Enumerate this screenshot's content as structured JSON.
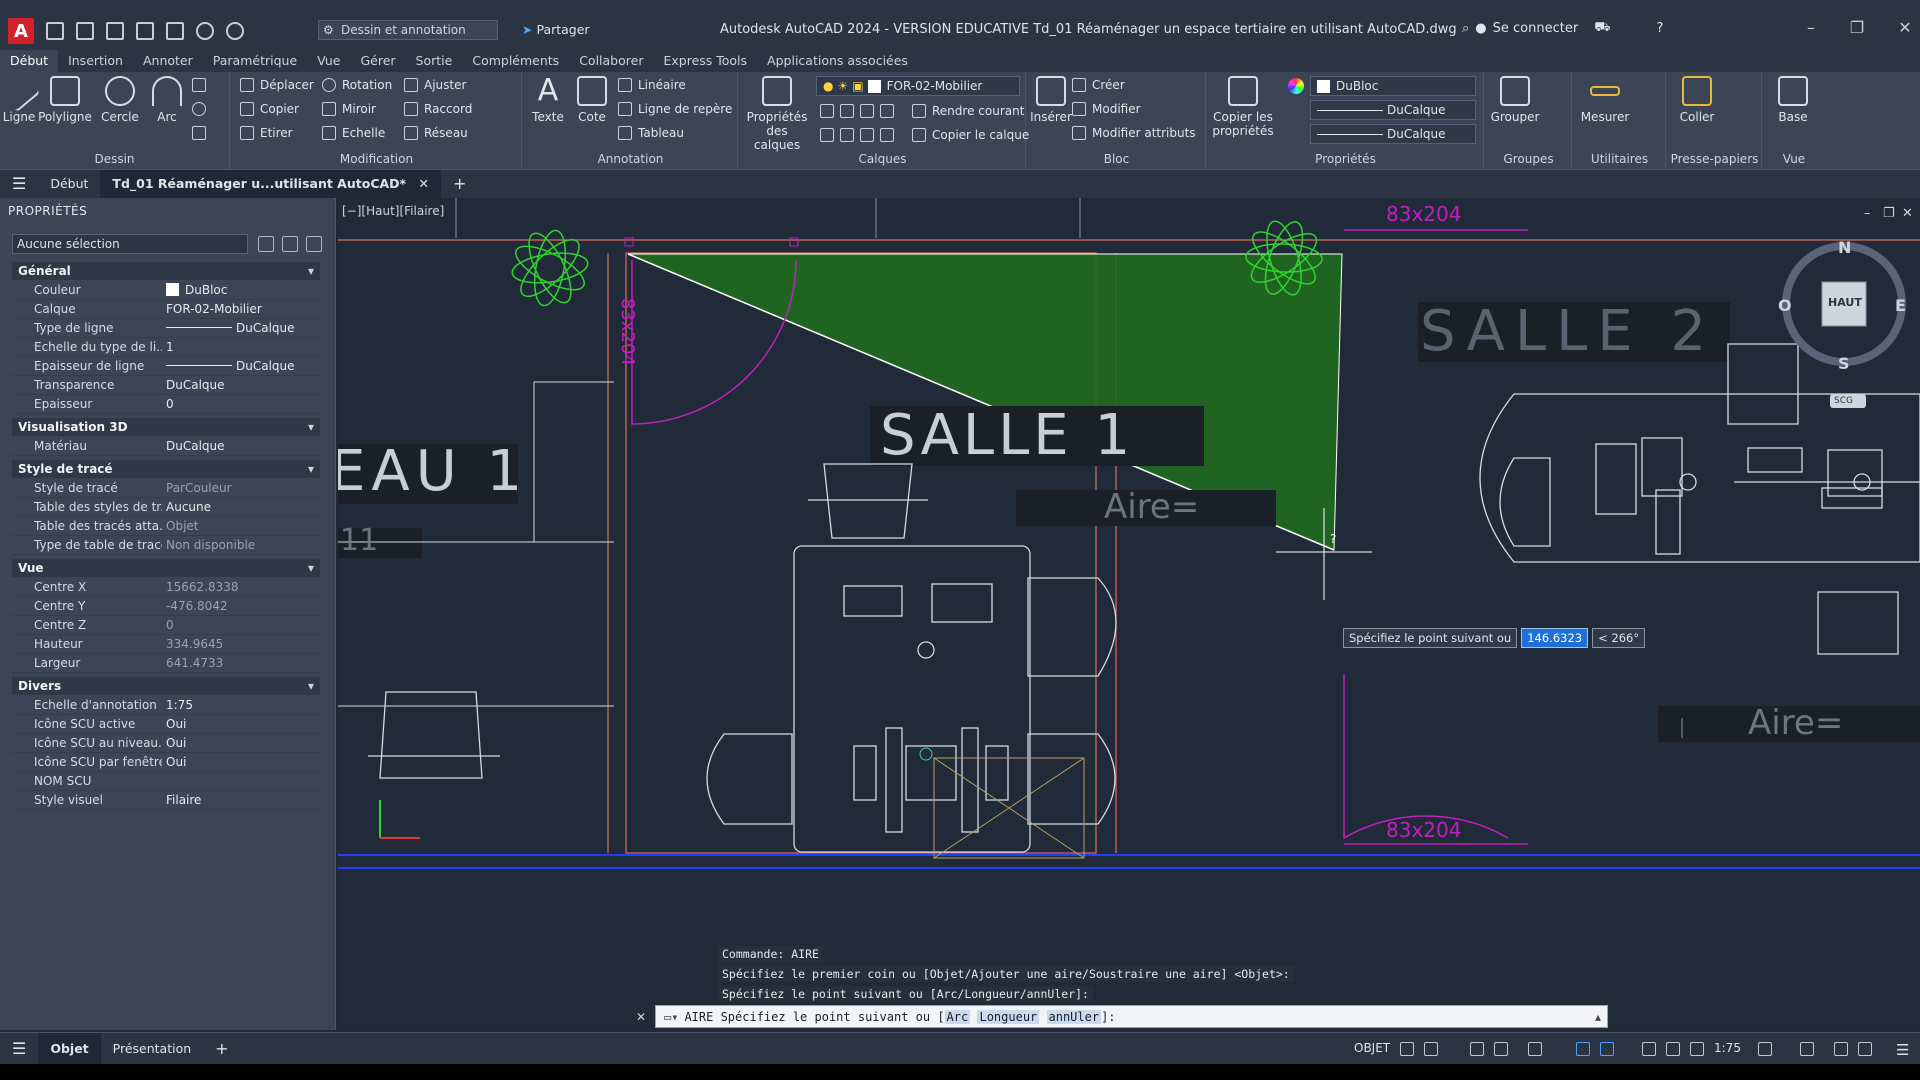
{
  "titlebar": {
    "workspace": "Dessin et annotation",
    "share": "Partager",
    "title": "Autodesk AutoCAD 2024 - VERSION EDUCATIVE    Td_01 Réaménager un espace tertiaire en utilisant AutoCAD.dwg",
    "signin": "Se connecter"
  },
  "menu": [
    "Début",
    "Insertion",
    "Annoter",
    "Paramétrique",
    "Vue",
    "Gérer",
    "Sortie",
    "Compléments",
    "Collaborer",
    "Express Tools",
    "Applications associées"
  ],
  "ribbon": {
    "dessin": {
      "label": "Dessin",
      "ligne": "Ligne",
      "polyligne": "Polyligne",
      "cercle": "Cercle",
      "arc": "Arc"
    },
    "modification": {
      "label": "Modification",
      "deplacer": "Déplacer",
      "rotation": "Rotation",
      "ajuster": "Ajuster",
      "copier": "Copier",
      "miroir": "Miroir",
      "raccord": "Raccord",
      "etirer": "Etirer",
      "echelle": "Echelle",
      "reseau": "Réseau"
    },
    "annotation": {
      "label": "Annotation",
      "texte": "Texte",
      "cote": "Cote",
      "lineaire": "Linéaire",
      "ligne_repere": "Ligne de repère",
      "tableau": "Tableau"
    },
    "calques": {
      "label": "Calques",
      "proprietes": "Propriétés des calques",
      "layer": "FOR-02-Mobilier",
      "rendre_courant": "Rendre courant",
      "copier_calque": "Copier le calque"
    },
    "bloc": {
      "label": "Bloc",
      "inserer": "Insérer",
      "creer": "Créer",
      "modifier": "Modifier",
      "modifier_attributs": "Modifier attributs"
    },
    "proprietes": {
      "label": "Propriétés",
      "copier": "Copier les propriétés",
      "color": "DuBloc",
      "linetype": "DuCalque",
      "lineweight": "DuCalque"
    },
    "groupes": {
      "label": "Groupes",
      "grouper": "Grouper"
    },
    "utilitaires": {
      "label": "Utilitaires",
      "mesurer": "Mesurer"
    },
    "presse": {
      "label": "Presse-papiers",
      "coller": "Coller"
    },
    "vue": {
      "label": "Vue",
      "base": "Base"
    }
  },
  "doctabs": {
    "start": "Début",
    "current": "Td_01 Réaménager u...utilisant AutoCAD*"
  },
  "properties": {
    "title": "PROPRIÉTÉS",
    "selection": "Aucune sélection",
    "sections": {
      "general": "Général",
      "vis3d": "Visualisation 3D",
      "trace": "Style de tracé",
      "vue": "Vue",
      "divers": "Divers"
    },
    "general": [
      {
        "k": "Couleur",
        "v": "DuBloc"
      },
      {
        "k": "Calque",
        "v": "FOR-02-Mobilier"
      },
      {
        "k": "Type de ligne",
        "v": "DuCalque"
      },
      {
        "k": "Echelle du type de li...",
        "v": "1"
      },
      {
        "k": "Epaisseur de ligne",
        "v": "DuCalque"
      },
      {
        "k": "Transparence",
        "v": "DuCalque"
      },
      {
        "k": "Epaisseur",
        "v": "0"
      }
    ],
    "vis3d": [
      {
        "k": "Matériau",
        "v": "DuCalque"
      }
    ],
    "trace": [
      {
        "k": "Style de tracé",
        "v": "ParCouleur"
      },
      {
        "k": "Table des styles de tr...",
        "v": "Aucune"
      },
      {
        "k": "Table des tracés atta...",
        "v": "Objet"
      },
      {
        "k": "Type de table de tracé",
        "v": "Non disponible"
      }
    ],
    "vue": [
      {
        "k": "Centre X",
        "v": "15662.8338"
      },
      {
        "k": "Centre Y",
        "v": "-476.8042"
      },
      {
        "k": "Centre Z",
        "v": "0"
      },
      {
        "k": "Hauteur",
        "v": "334.9645"
      },
      {
        "k": "Largeur",
        "v": "641.4733"
      }
    ],
    "divers": [
      {
        "k": "Echelle d'annotation",
        "v": "1:75"
      },
      {
        "k": "Icône SCU active",
        "v": "Oui"
      },
      {
        "k": "Icône SCU au niveau...",
        "v": "Oui"
      },
      {
        "k": "Icône SCU par fenêtre",
        "v": "Oui"
      },
      {
        "k": "NOM SCU",
        "v": ""
      },
      {
        "k": "Style visuel",
        "v": "Filaire"
      }
    ]
  },
  "viewport": {
    "label": "[−][Haut][Filaire]",
    "salle1": "SALLE 1",
    "salle2": "SALLE 2",
    "bureau": "EAU 1",
    "bureau_sub": "11",
    "aire": "Aire=",
    "dim": "83x204",
    "compass": {
      "n": "N",
      "s": "S",
      "e": "E",
      "o": "O",
      "center": "HAUT",
      "scu": "SCG"
    },
    "cursor_q": "?"
  },
  "tooltip": {
    "prompt": "Spécifiez le point suivant ou",
    "value": "146.6323",
    "angle": "< 266°"
  },
  "command": {
    "history": [
      "Commande: AIRE",
      "Spécifiez le premier coin ou [Objet/Ajouter une aire/Soustraire une aire] <Objet>:",
      "Spécifiez le point suivant ou [Arc/Longueur/annUler]:"
    ],
    "prefix": "AIRE Spécifiez le point suivant ou [",
    "kw1": "Arc",
    "kw2": "Longueur",
    "kw3": "annUler",
    "suffix": "]:"
  },
  "status": {
    "tab_objet": "Objet",
    "tab_pres": "Présentation",
    "mode": "OBJET",
    "scale": "1:75"
  },
  "colors": {
    "accent": "#1e6fd6",
    "fill": "#1f6b1f",
    "wall": "#e06a5a",
    "door": "#c020c0",
    "plant": "#2fd32f"
  }
}
